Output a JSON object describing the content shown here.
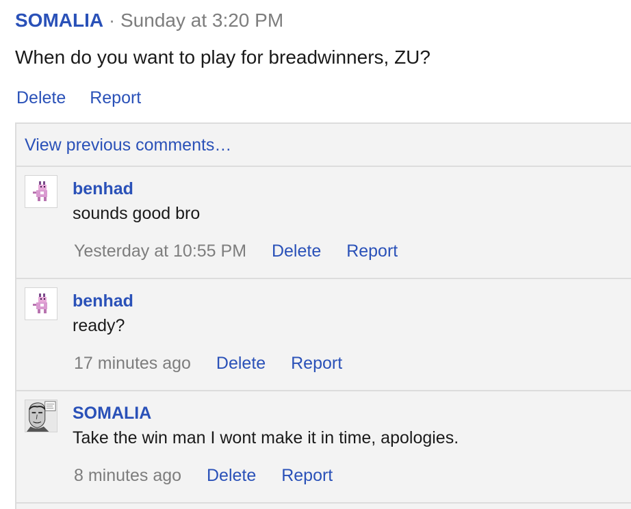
{
  "post": {
    "author": "SOMALIA",
    "separator": "·",
    "time": "Sunday at 3:20 PM",
    "body": "When do you want to play for breadwinners, ZU?",
    "delete_label": "Delete",
    "report_label": "Report"
  },
  "comments_section": {
    "view_previous_label": "View previous comments…"
  },
  "comments": [
    {
      "author": "benhad",
      "text": "sounds good bro",
      "time": "Yesterday at 10:55 PM",
      "delete_label": "Delete",
      "report_label": "Report",
      "avatar_icon": "cat-sprite-icon"
    },
    {
      "author": "benhad",
      "text": "ready?",
      "time": "17 minutes ago",
      "delete_label": "Delete",
      "report_label": "Report",
      "avatar_icon": "cat-sprite-icon"
    },
    {
      "author": "SOMALIA",
      "text": "Take the win man I wont make it in time, apologies.",
      "time": "8 minutes ago",
      "delete_label": "Delete",
      "report_label": "Report",
      "avatar_icon": "manga-portrait-icon"
    }
  ],
  "colors": {
    "link": "#2a51b8",
    "muted": "#7d7d7d",
    "comments_bg": "#f3f3f3",
    "border": "#dcdcdc"
  }
}
